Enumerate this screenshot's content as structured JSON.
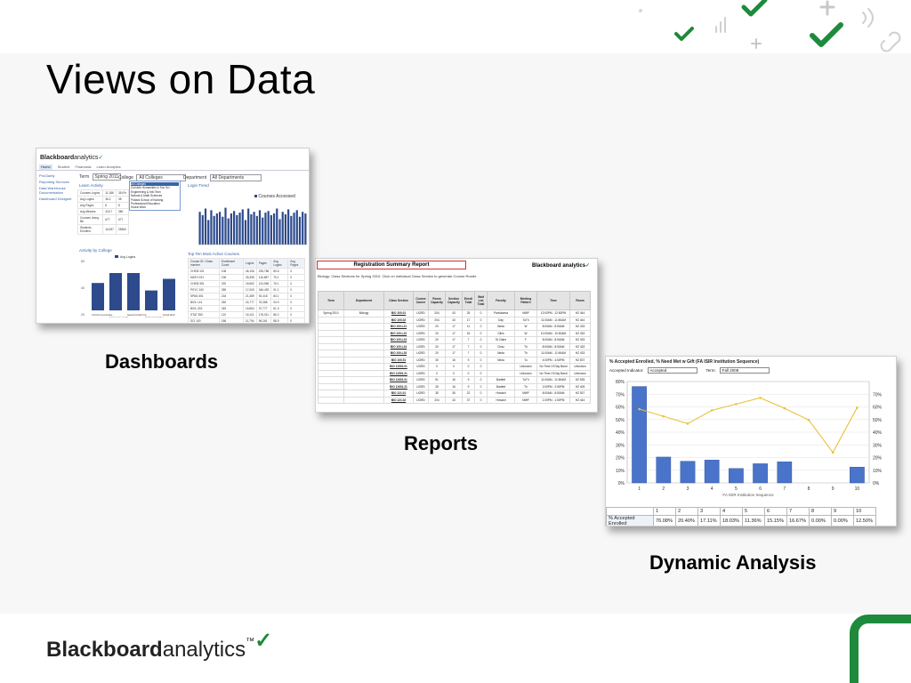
{
  "slide": {
    "title": "Views on Data",
    "captions": {
      "dashboards": "Dashboards",
      "reports": "Reports",
      "dynamic": "Dynamic Analysis"
    },
    "footer_brand_bold": "Blackboard",
    "footer_brand_light": "analytics",
    "footer_tm": "™",
    "colors": {
      "brand_green": "#1e8a3c",
      "accent_blue": "#3a64a8"
    }
  },
  "dashboard": {
    "brand_bold": "Blackboard",
    "brand_light": "analytics",
    "tabs": [
      "Home",
      "Student",
      "Financials",
      "Learn Analytics"
    ],
    "side_links": [
      "ProClarity",
      "Reporting Services",
      "Data Warehouse Documentation",
      "Dashboard Designer"
    ],
    "filters": {
      "term_label": "Term",
      "term_value": "Spring 2011",
      "college_label": "College",
      "college_value": "All Colleges",
      "dept_label": "Department",
      "dept_value": "All Departments"
    },
    "sections": {
      "learn_activity": "Learn Activity",
      "login_trend": "Login Trend",
      "activity_by_college": "Activity by College",
      "top_ten": "Top Ten Most Active Courses"
    },
    "dropdown_options": [
      "All Colleges",
      "Coll Arts Humanities & Soc Sci",
      "Engineering & Info Tech",
      "Natural & Math Sciences",
      "Pollack School of Nursing",
      "Professional Education",
      "Social Work"
    ],
    "metrics": [
      {
        "name": "Courses Logins",
        "active": "11,186",
        "pct": "35.0%"
      },
      {
        "name": "Avg Logins",
        "active": "36.2",
        "pct": "38"
      },
      {
        "name": "Avg Pages",
        "active": "8",
        "pct": "8"
      },
      {
        "name": "Avg Minutes",
        "active": "315.7",
        "pct": "380"
      },
      {
        "name": "Courses Using Bb",
        "active": "677",
        "pct": "677"
      },
      {
        "name": "Students Enrolled",
        "active": "16,537",
        "pct": "28360"
      }
    ],
    "login_legend": "Courses Accessed",
    "college_chart_legend": "Avg Logins",
    "college_bars": [
      33,
      45,
      45,
      24,
      38
    ],
    "college_labels": [
      "Coll Arts Humanities",
      "Engineering & Info",
      "Natural & Math Sci",
      "Professional Educ",
      "Social Work"
    ],
    "trend_bars": [
      40,
      36,
      44,
      30,
      42,
      35,
      38,
      40,
      34,
      45,
      32,
      38,
      41,
      36,
      39,
      43,
      30,
      44,
      37,
      40,
      35,
      42,
      33,
      39,
      41,
      36,
      38,
      44,
      31,
      40,
      37,
      43,
      35,
      39,
      42,
      34,
      40,
      38
    ],
    "top_ten_header": [
      "Course ID / Class number",
      "Enrollment Count",
      "Logins",
      "Pages",
      "Avg Logins",
      "Avg Pages"
    ],
    "top_ten_rows": [
      [
        "CHEM 101",
        "108",
        "46,106",
        "226,786",
        "80.6",
        "0"
      ],
      [
        "MATH 151",
        "196",
        "26,355",
        "116,587",
        "75.1",
        "0"
      ],
      [
        "CHEM 351",
        "220",
        "16,652",
        "124,556",
        "76.1",
        "0"
      ],
      [
        "PSYC 100",
        "395",
        "17,000",
        "346,492",
        "91.1",
        "0"
      ],
      [
        "SPAN 301",
        "218",
        "21,389",
        "92,418",
        "84.1",
        "0"
      ],
      [
        "BIOL 141",
        "260",
        "24,777",
        "76,388",
        "94.9",
        "0"
      ],
      [
        "BIOL 302",
        "245",
        "15,864",
        "97,777",
        "61.3",
        "0"
      ],
      [
        "STAT 350",
        "110",
        "16,101",
        "176,011",
        "86.2",
        "0"
      ],
      [
        "SCI 100",
        "186",
        "11,794",
        "96,261",
        "88.9",
        "0"
      ],
      [
        "IS 300",
        "141",
        "11,717",
        "121,151",
        "106.0",
        "0"
      ]
    ]
  },
  "report": {
    "title": "Registration Summary Report",
    "brand": "Blackboard analytics",
    "subtitle": "Biology: Class Sections for Spring 2010. Click on individual Class Section to generate Course Roster.",
    "columns": [
      "Term",
      "Department",
      "Class Section",
      "Course Career",
      "Room Capacity",
      "Section Capacity",
      "Enroll Total",
      "Wait List Total",
      "Faculty",
      "Meeting Pattern",
      "Time",
      "Room"
    ],
    "rows": [
      [
        "Spring 2010",
        "Biology",
        "BIO 100.01",
        "UGRD",
        "204",
        "43",
        "25",
        "0",
        "Pantolaeva",
        "MWF",
        "12:00PM - 12:50PM",
        "HZ 444"
      ],
      [
        "",
        "",
        "BIO 100.02",
        "UGRD",
        "204",
        "43",
        "17",
        "0",
        "Day",
        "TuTh",
        "11:00AM - 11:50AM",
        "HZ 444"
      ],
      [
        "",
        "",
        "BIO 100.L21",
        "UGRD",
        "20",
        "17",
        "11",
        "0",
        "Ilieda",
        "W",
        "8:00AM - 8:50AM",
        "HZ 433"
      ],
      [
        "",
        "",
        "BIO 100.L22",
        "UGRD",
        "20",
        "17",
        "16",
        "0",
        "Giles",
        "W",
        "10:00AM - 10:50AM",
        "HZ 433"
      ],
      [
        "",
        "",
        "BIO 100.L23",
        "UGRD",
        "20",
        "17",
        "7",
        "0",
        "St Claire",
        "F",
        "8:00AM - 8:50AM",
        "HZ 433"
      ],
      [
        "",
        "",
        "BIO 100.L24",
        "UGRD",
        "20",
        "17",
        "7",
        "0",
        "Chau",
        "Th",
        "8:00AM - 8:50AM",
        "HZ 433"
      ],
      [
        "",
        "",
        "BIO 100.L25",
        "UGRD",
        "20",
        "17",
        "7",
        "0",
        "Ilieda",
        "Th",
        "11:00AM - 11:50AM",
        "HZ 433"
      ],
      [
        "",
        "",
        "BIO 100.51",
        "UGRD",
        "30",
        "16",
        "9",
        "0",
        "Ilieda",
        "Tu",
        "4:00PM - 4:50PM",
        "HZ 537"
      ],
      [
        "",
        "",
        "BIO 11501.01",
        "UGRD",
        "0",
        "0",
        "0",
        "0",
        "",
        "Unknown",
        "No Time Of Day Band",
        "Unknown"
      ],
      [
        "",
        "",
        "BIO 11501.21",
        "UGRD",
        "0",
        "0",
        "0",
        "0",
        "",
        "Unknown",
        "No Time Of Day Band",
        "Unknown"
      ],
      [
        "",
        "",
        "BIO 11601.01",
        "UGRD",
        "51",
        "16",
        "9",
        "0",
        "Bartlett",
        "TuTh",
        "11:00AM - 11:50AM",
        "HZ 535"
      ],
      [
        "",
        "",
        "BIO 11601.21",
        "UGRD",
        "25",
        "16",
        "9",
        "0",
        "Bartlett",
        "Th",
        "2:00PM - 2:50PM",
        "HZ 405"
      ],
      [
        "",
        "",
        "BIO 121.01",
        "UGRD",
        "35",
        "35",
        "22",
        "0",
        "Howard",
        "MWF",
        "8:00AM - 8:50AM",
        "HZ 537"
      ],
      [
        "",
        "",
        "BIO 121.02",
        "UGRD",
        "204",
        "43",
        "37",
        "0",
        "Howard",
        "MWF",
        "1:00PM - 1:50PM",
        "HZ 444"
      ]
    ]
  },
  "analysis": {
    "title": "% Accepted Enrolled, % Need Met w Gift (FA ISIR Institution Sequence)",
    "indicator_label": "Accepted Indicator:",
    "indicator_value": "Accepted",
    "term_label": "Term:",
    "term_value": "Fall 2008",
    "row_labels": [
      "% Accepted Enrolled",
      "% Need Met w Gift"
    ],
    "col_header": [
      "1",
      "2",
      "3",
      "4",
      "5",
      "6",
      "7",
      "8",
      "9",
      "10"
    ],
    "row1": [
      "76.08%",
      "20.40%",
      "17.11%",
      "18.03%",
      "11.36%",
      "15.15%",
      "16.67%",
      "0.00%",
      "0.00%",
      "12.50%"
    ],
    "row2": [
      "58.24%",
      "52.53%",
      "46.79%",
      "57.26%",
      "62.19%",
      "67.11%",
      "58.84%",
      "49.72%",
      "23.99%",
      "59.34%"
    ]
  },
  "chart_data": {
    "type": "bar",
    "title": "% Accepted Enrolled, % Need Met w Gift (FA ISIR Institution Sequence)",
    "xlabel": "FA ISIR Institution Sequence",
    "ylabel": "",
    "categories": [
      "1",
      "2",
      "3",
      "4",
      "5",
      "6",
      "7",
      "8",
      "9",
      "10"
    ],
    "series": [
      {
        "name": "% Accepted Enrolled",
        "type": "bar",
        "values": [
          76.08,
          20.4,
          17.11,
          18.03,
          11.36,
          15.15,
          16.67,
          0.0,
          0.0,
          12.5
        ]
      },
      {
        "name": "% Need Met w Gift",
        "type": "line",
        "values": [
          58.24,
          52.53,
          46.79,
          57.26,
          62.19,
          67.11,
          58.84,
          49.72,
          23.99,
          59.34
        ]
      }
    ],
    "ylim": [
      0,
      80
    ],
    "yticks": [
      "0%",
      "10%",
      "20%",
      "30%",
      "40%",
      "50%",
      "60%",
      "70%",
      "80%"
    ],
    "y2ticks": [
      "0%",
      "10%",
      "20%",
      "30%",
      "40%",
      "50%",
      "60%",
      "70%"
    ],
    "grid": true,
    "bar_color": "#4a74c9",
    "line_color": "#e8c23a"
  }
}
